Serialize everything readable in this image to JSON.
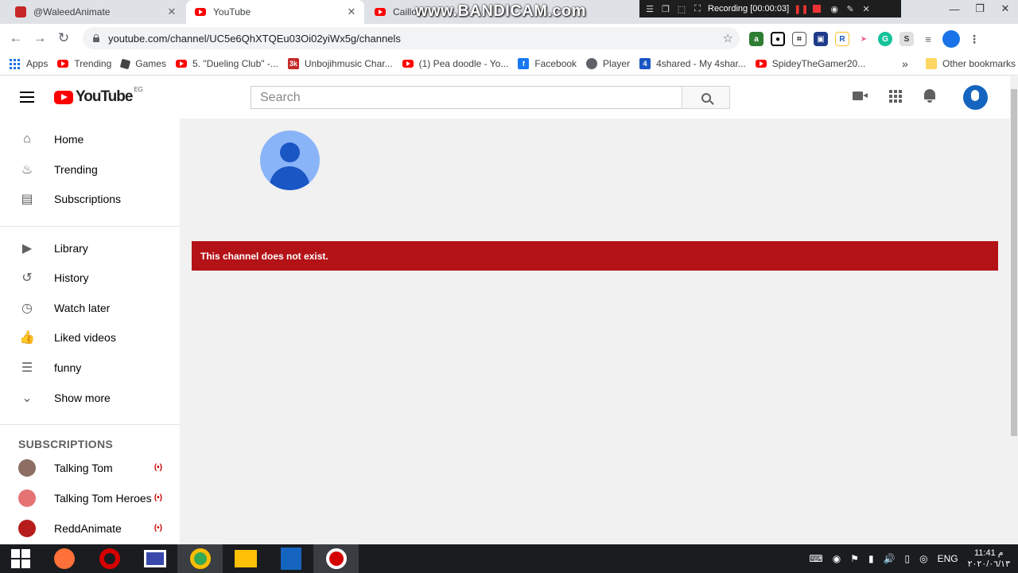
{
  "browser": {
    "tabs": [
      {
        "title": "@WaleedAnimate",
        "active": false
      },
      {
        "title": "YouTube",
        "active": true
      },
      {
        "title": "Caillou",
        "active": false
      }
    ],
    "watermark": "www.BANDICAM.com",
    "recording_label": "Recording [00:00:03]",
    "url": "youtube.com/channel/UC5e6QhXTQEu03Oi02yiWx5g/channels",
    "bookmarks": [
      {
        "label": "Apps",
        "icon": "apps-grid-icon"
      },
      {
        "label": "Trending",
        "icon": "youtube-icon"
      },
      {
        "label": "Games",
        "icon": "roblox-icon"
      },
      {
        "label": "5. \"Dueling Club\" -...",
        "icon": "youtube-icon"
      },
      {
        "label": "Unbojihmusic Char...",
        "icon": "3k-icon"
      },
      {
        "label": "(1) Pea doodle - Yo...",
        "icon": "youtube-icon"
      },
      {
        "label": "Facebook",
        "icon": "facebook-icon"
      },
      {
        "label": "Player",
        "icon": "globe-icon"
      },
      {
        "label": "4shared - My 4shar...",
        "icon": "4shared-icon"
      },
      {
        "label": "SpideyTheGamer20...",
        "icon": "youtube-icon"
      }
    ],
    "bookmarks_overflow": "»",
    "other_bookmarks": "Other bookmarks"
  },
  "youtube": {
    "logo_text": "YouTube",
    "country_code": "EG",
    "search_placeholder": "Search",
    "sidebar": {
      "primary": [
        {
          "label": "Home",
          "icon": "home-icon"
        },
        {
          "label": "Trending",
          "icon": "flame-icon"
        },
        {
          "label": "Subscriptions",
          "icon": "subscriptions-icon"
        }
      ],
      "library": [
        {
          "label": "Library",
          "icon": "library-icon"
        },
        {
          "label": "History",
          "icon": "history-icon"
        },
        {
          "label": "Watch later",
          "icon": "clock-icon"
        },
        {
          "label": "Liked videos",
          "icon": "thumbs-up-icon"
        },
        {
          "label": "funny",
          "icon": "playlist-icon"
        },
        {
          "label": "Show more",
          "icon": "chevron-down-icon"
        }
      ],
      "subscriptions_heading": "SUBSCRIPTIONS",
      "subscriptions": [
        {
          "label": "Talking Tom",
          "live": true
        },
        {
          "label": "Talking Tom Heroes",
          "live": true
        },
        {
          "label": "ReddAnimate",
          "live": true
        }
      ],
      "live_glyph": "(•)"
    },
    "error_message": "This channel does not exist."
  },
  "taskbar": {
    "language": "ENG",
    "time": "11:41 م",
    "date": "٢٠٢٠/٠٦/١٣"
  },
  "colors": {
    "youtube_red": "#ff0000",
    "error_banner": "#b31217",
    "chrome_tabstrip": "#dee1e6"
  }
}
